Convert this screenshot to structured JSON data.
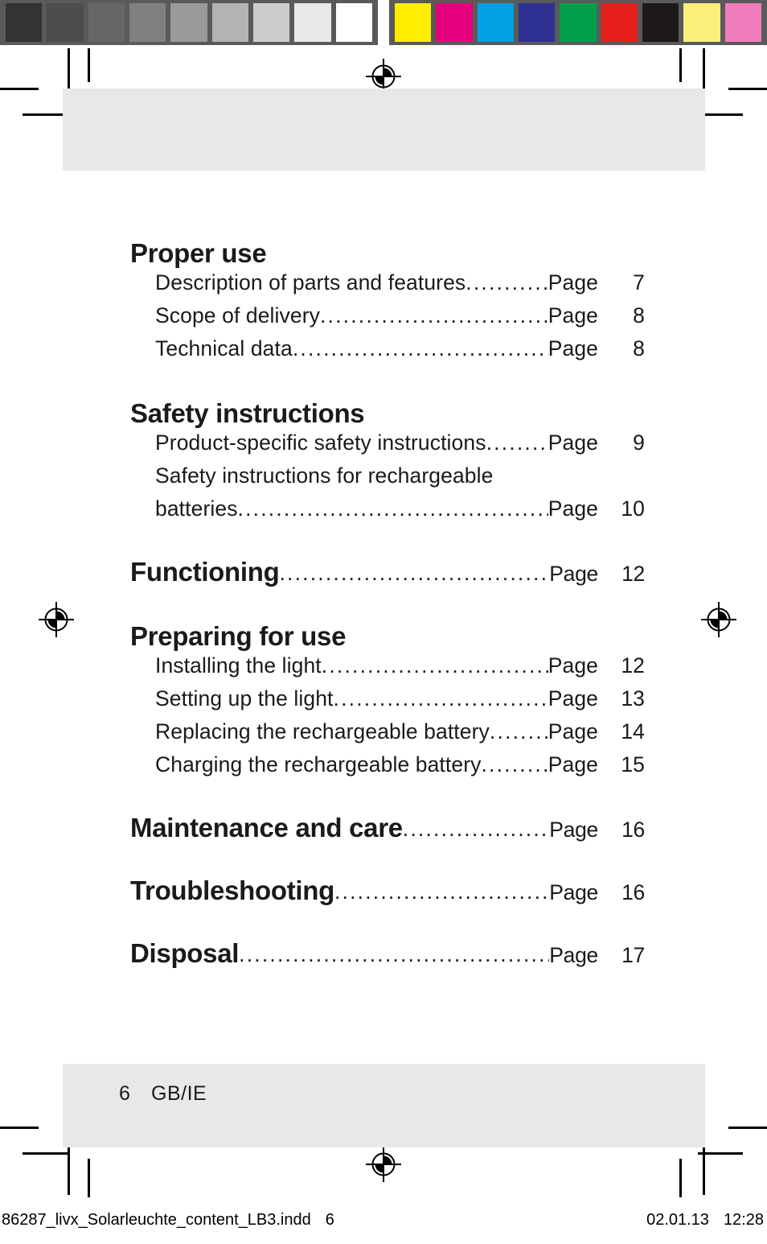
{
  "calibration": {
    "grayscale_swatches": [
      "#333333",
      "#4d4d4d",
      "#666666",
      "#808080",
      "#9a9a9a",
      "#b3b3b3",
      "#cccccc",
      "#e8e8e8",
      "#ffffff"
    ],
    "color_swatches": [
      "#ffed00",
      "#e5007d",
      "#00a0e3",
      "#2e3192",
      "#00a04b",
      "#e61e19",
      "#1f1a1a",
      "#fdef7d",
      "#f07dbd"
    ]
  },
  "toc": {
    "sections": [
      {
        "type": "group",
        "title": "Proper use",
        "entries": [
          {
            "label": "Description of parts and features",
            "page_word": "Page",
            "page": "7"
          },
          {
            "label": "Scope of delivery",
            "page_word": "Page",
            "page": "8"
          },
          {
            "label": "Technical data",
            "page_word": "Page",
            "page": "8"
          }
        ]
      },
      {
        "type": "group",
        "title": "Safety instructions",
        "entries": [
          {
            "label": "Product-specific safety instructions",
            "page_word": "Page",
            "page": "9"
          },
          {
            "label": "Safety instructions for rechargeable",
            "continuation": true
          },
          {
            "label": "batteries",
            "page_word": "Page",
            "page": "10"
          }
        ]
      },
      {
        "type": "heading",
        "title": "Functioning",
        "page_word": "Page",
        "page": "12"
      },
      {
        "type": "group",
        "title": "Preparing for use",
        "entries": [
          {
            "label": "Installing the light",
            "page_word": "Page",
            "page": "12"
          },
          {
            "label": "Setting up the light",
            "page_word": "Page",
            "page": "13"
          },
          {
            "label": "Replacing the rechargeable battery",
            "page_word": "Page",
            "page": "14"
          },
          {
            "label": "Charging the rechargeable battery",
            "page_word": "Page",
            "page": "15"
          }
        ]
      },
      {
        "type": "heading",
        "title": "Maintenance and care",
        "page_word": "Page",
        "page": "16"
      },
      {
        "type": "heading",
        "title": "Troubleshooting",
        "page_word": "Page",
        "page": "16"
      },
      {
        "type": "heading",
        "title": "Disposal",
        "page_word": "Page",
        "page": "17"
      }
    ]
  },
  "footer": {
    "page_number": "6",
    "locale": "GB/IE"
  },
  "production_slug": {
    "filename": "86287_livx_Solarleuchte_content_LB3.indd",
    "sheet": "6",
    "date": "02.01.13",
    "time": "12:28"
  }
}
